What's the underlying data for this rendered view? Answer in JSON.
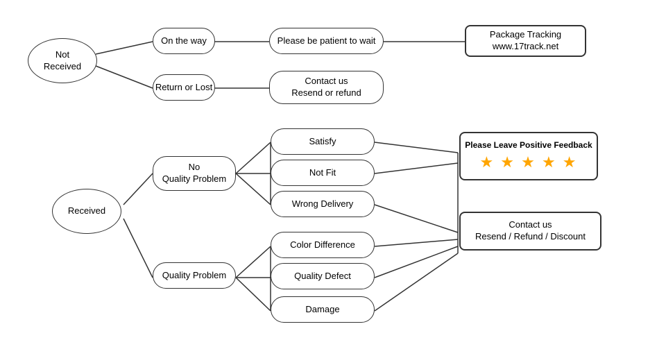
{
  "nodes": {
    "not_received": {
      "label": "Not\nReceived"
    },
    "on_the_way": {
      "label": "On the way"
    },
    "patient": {
      "label": "Please be patient to wait"
    },
    "package_tracking": {
      "label": "Package Tracking\nwww.17track.net"
    },
    "return_lost": {
      "label": "Return or Lost"
    },
    "contact_resend": {
      "label": "Contact us\nResend or refund"
    },
    "received": {
      "label": "Received"
    },
    "no_quality": {
      "label": "No\nQuality Problem"
    },
    "satisfy": {
      "label": "Satisfy"
    },
    "not_fit": {
      "label": "Not Fit"
    },
    "wrong_delivery": {
      "label": "Wrong Delivery"
    },
    "feedback": {
      "label": "Please Leave Positive Feedback"
    },
    "stars": {
      "label": "★ ★ ★ ★ ★"
    },
    "quality_problem": {
      "label": "Quality Problem"
    },
    "color_diff": {
      "label": "Color Difference"
    },
    "quality_defect": {
      "label": "Quality Defect"
    },
    "damage": {
      "label": "Damage"
    },
    "contact_refund": {
      "label": "Contact us\nResend / Refund / Discount"
    }
  }
}
